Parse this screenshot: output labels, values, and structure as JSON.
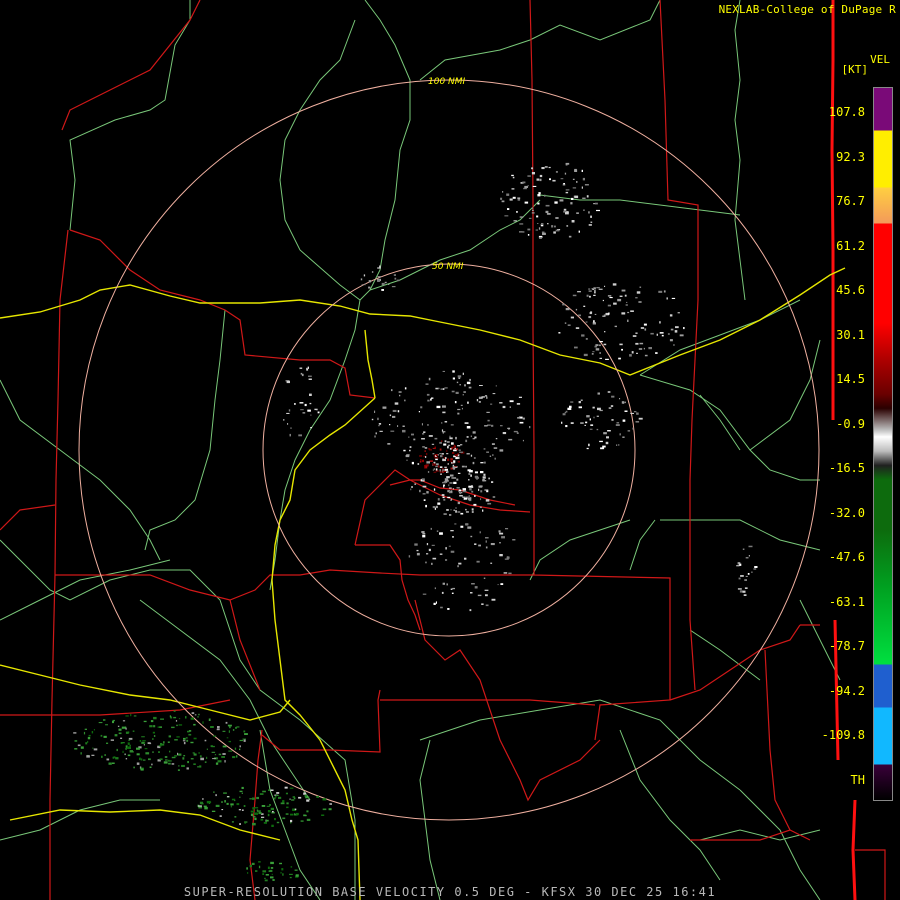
{
  "credit": "NEXLAB-College of DuPage",
  "credit_mark": "R",
  "footer": "SUPER-RESOLUTION BASE VELOCITY 0.5 DEG - KFSX 30 DEC 25 16:41",
  "range_rings": [
    {
      "label": "50 NMI"
    },
    {
      "label": "100 NMI"
    }
  ],
  "legend": {
    "product": "VEL",
    "unit": "[KT]",
    "ticks": [
      "107.8",
      "92.3",
      "76.7",
      "61.2",
      "45.6",
      "30.1",
      "14.5",
      "-0.9",
      "-16.5",
      "-32.0",
      "-47.6",
      "-63.1",
      "-78.7",
      "-94.2",
      "-109.8",
      "TH"
    ],
    "colors": {
      "purple": "#7a0a78",
      "yellow": "#ffee00",
      "orange": "#f39a5a",
      "red": "#ff0000",
      "dark_red": "#6a0000",
      "gray": "#bdbdbd",
      "dark_green": "#0d6b0d",
      "green": "#00e040",
      "blue": "#1f5fcf",
      "light_blue": "#11b8ff",
      "th_purple": "#3a003a"
    }
  },
  "map_colors": {
    "state_line": "#d01818",
    "county_line": "#79c779",
    "highway": "#e6e600",
    "ring": "#f0b0a0"
  }
}
